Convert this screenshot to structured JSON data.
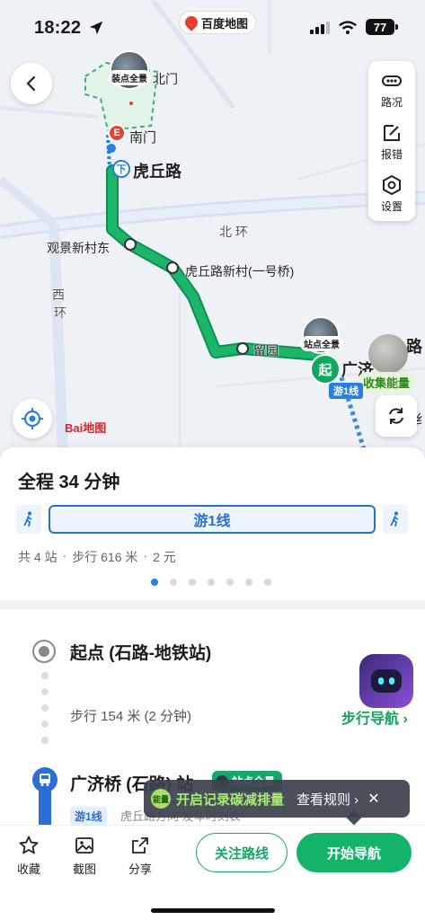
{
  "status_bar": {
    "time": "18:22",
    "app_badge": "百度地图",
    "battery": "77"
  },
  "map": {
    "labels": {
      "north_gate": "北门",
      "south_gate": "南门",
      "hqr": "虎丘路",
      "north_ring": "北 环",
      "west_ring_1": "西",
      "west_ring_2": "环",
      "guanjing": "观景新村东",
      "hqrxc": "虎丘路新村(一号桥)",
      "liuyuan": "留园",
      "guangji": "广济",
      "road_right": "路",
      "right_edge": "纟"
    },
    "thumb_top": "装点全景",
    "thumb_station": "站点全景",
    "start_pin": "起",
    "line_tag": "游1线",
    "energy_tag": "收集能量",
    "stop_down": "下",
    "logo": "Bai地图",
    "tools": {
      "traffic": "路况",
      "report": "报错",
      "settings": "设置"
    }
  },
  "summary": {
    "title": "全程 34 分钟",
    "line": "游1线",
    "stops": "共 4 站",
    "walk": "步行 616 米",
    "price": "2 元"
  },
  "steps": {
    "origin": "起点 (石路-地铁站)",
    "walk_text": "步行 154 米 (2 分钟)",
    "walk_nav": "步行导航",
    "station": "广济桥 (石路) 站",
    "station_tag": "站点全景",
    "route_line": "游1线",
    "route_dir": "虎丘路方向 发车时刻表"
  },
  "toast": {
    "chip": "能量",
    "message": "开启记录碳减排量",
    "rule": "查看规则 ›",
    "close": "✕"
  },
  "bottom": {
    "favorite": "收藏",
    "screenshot": "截图",
    "share": "分享",
    "follow": "关注路线",
    "navigate": "开始导航"
  },
  "colors": {
    "route_green": "#13a860",
    "brand_blue": "#2a7de1"
  }
}
